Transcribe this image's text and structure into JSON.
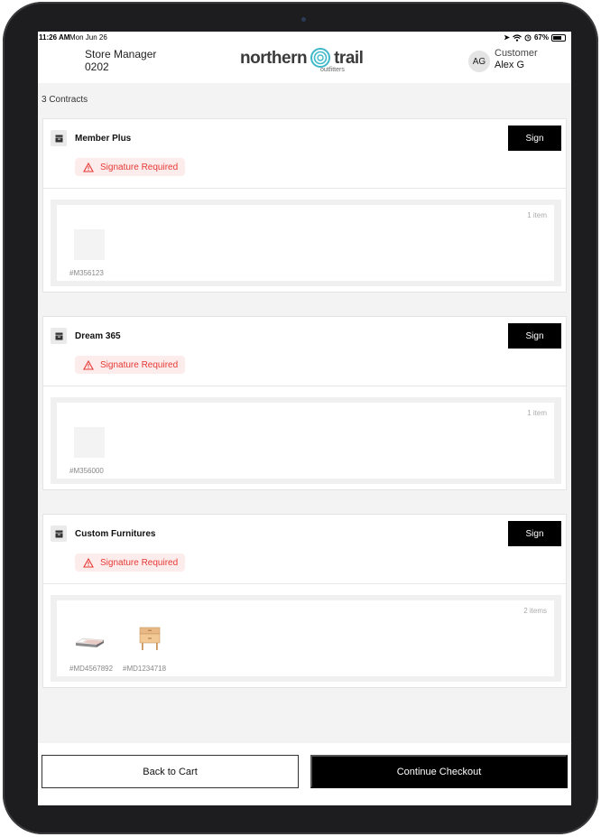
{
  "status_bar": {
    "time": "11:26 AM",
    "date": "Mon Jun 26",
    "battery": "67%"
  },
  "header": {
    "store_role": "Store Manager",
    "store_id": "0202",
    "logo_word1": "northern",
    "logo_word2": "trail",
    "logo_sub": "outfitters",
    "avatar_initials": "AG",
    "customer_role": "Customer",
    "customer_name": "Alex G"
  },
  "contracts_count": "3 Contracts",
  "contracts": [
    {
      "title": "Member Plus",
      "sign_label": "Sign",
      "status": "Signature Required",
      "item_count": "1 item",
      "skus": [
        "#M356123"
      ]
    },
    {
      "title": "Dream 365",
      "sign_label": "Sign",
      "status": "Signature Required",
      "item_count": "1 item",
      "skus": [
        "#M356000"
      ]
    },
    {
      "title": "Custom Furnitures",
      "sign_label": "Sign",
      "status": "Signature Required",
      "item_count": "2 items",
      "skus": [
        "#MD4567892",
        "#MD1234718"
      ]
    }
  ],
  "footer": {
    "back_label": "Back to Cart",
    "continue_label": "Continue Checkout"
  },
  "colors": {
    "accent": "#000000",
    "warning_text": "#e53935",
    "warning_bg": "#fdecec",
    "logo_ring": "#3fb8c9"
  }
}
